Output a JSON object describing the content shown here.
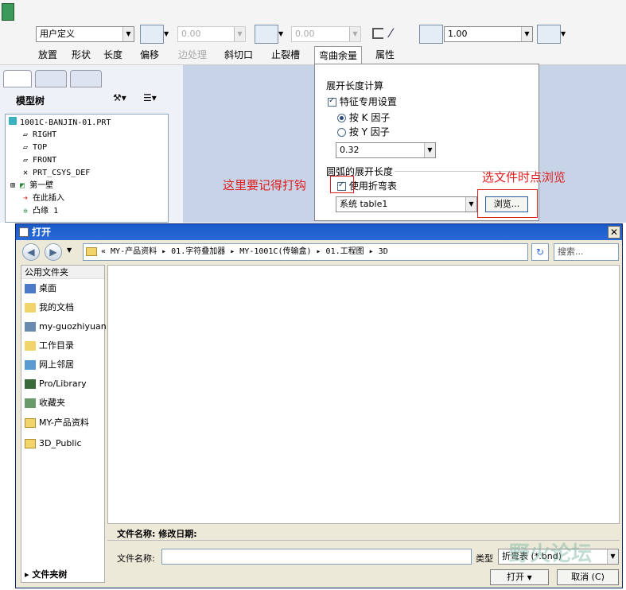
{
  "toolbar": {
    "type_combo": "用户定义",
    "val1": "0.00",
    "val2": "0.00",
    "val3": "1.00",
    "tabs": [
      "放置",
      "形状",
      "长度",
      "偏移",
      "边处理",
      "斜切口",
      "止裂槽",
      "弯曲余量",
      "属性"
    ]
  },
  "tree": {
    "header": "模型树",
    "items": [
      "1001C-BANJIN-01.PRT",
      "RIGHT",
      "TOP",
      "FRONT",
      "PRT_CSYS_DEF",
      "第一壁",
      "在此插入",
      "凸缘 1"
    ]
  },
  "panel": {
    "section1": "展开长度计算",
    "feature_check": "特征专用设置",
    "radio_k": "按 K 因子",
    "radio_y": "按 Y 因子",
    "factor_value": "0.32",
    "section2": "圆弧的展开长度",
    "use_bend_table": "使用折弯表",
    "table_value": "系统 table1",
    "browse": "浏览..."
  },
  "annotations": {
    "check_note": "这里要记得打钩",
    "browse_note": "选文件时点浏览"
  },
  "dialog": {
    "title": "打开",
    "path": "« MY-产品资料 ▸ 01.字符叠加器 ▸ MY-1001C(传输盒) ▸ 01.工程图 ▸ 3D",
    "search_placeholder": "搜索...",
    "sidebar_title": "公用文件夹",
    "sidebar_items": [
      "桌面",
      "我的文档",
      "my-guozhiyuan",
      "工作目录",
      "网上邻居",
      "Pro/Library",
      "收藏夹",
      "MY-产品资料",
      "3D_Public"
    ],
    "folder_tree": "文件夹树",
    "info_label": "文件名称:  修改日期:",
    "filename_label": "文件名称:",
    "type_label": "类型",
    "type_value": "折弯表 (*.bnd)",
    "open_button": "打开",
    "cancel_button": "取消 (C)"
  },
  "watermark": "野火论坛"
}
